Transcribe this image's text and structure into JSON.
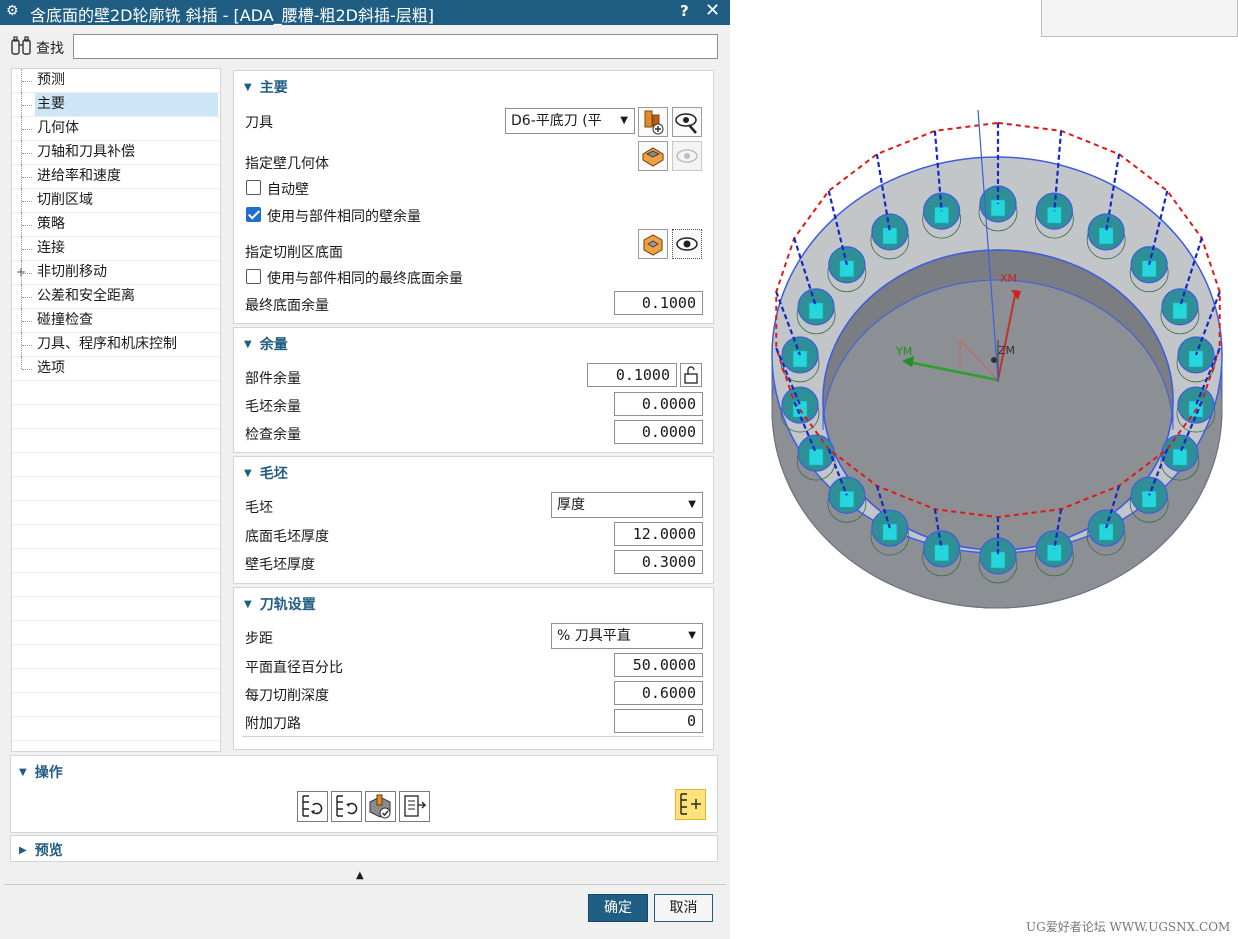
{
  "window": {
    "title": "含底面的壁2D轮廓铣 斜插 - [ADA_腰槽-粗2D斜插-层粗]",
    "help_label": "?",
    "close_label": "✕"
  },
  "find": {
    "label": "查找",
    "value": ""
  },
  "tree": {
    "items": [
      {
        "label": "预测",
        "selected": false,
        "expandable": false
      },
      {
        "label": "主要",
        "selected": true,
        "expandable": false
      },
      {
        "label": "几何体",
        "selected": false,
        "expandable": false
      },
      {
        "label": "刀轴和刀具补偿",
        "selected": false,
        "expandable": false
      },
      {
        "label": "进给率和速度",
        "selected": false,
        "expandable": false
      },
      {
        "label": "切削区域",
        "selected": false,
        "expandable": false
      },
      {
        "label": "策略",
        "selected": false,
        "expandable": false
      },
      {
        "label": "连接",
        "selected": false,
        "expandable": false
      },
      {
        "label": "非切削移动",
        "selected": false,
        "expandable": true
      },
      {
        "label": "公差和安全距离",
        "selected": false,
        "expandable": false
      },
      {
        "label": "碰撞检查",
        "selected": false,
        "expandable": false
      },
      {
        "label": "刀具、程序和机床控制",
        "selected": false,
        "expandable": false
      },
      {
        "label": "选项",
        "selected": false,
        "expandable": false
      }
    ]
  },
  "main_section": {
    "header": "主要",
    "tool_label": "刀具",
    "tool_value": "D6-平底刀 (平",
    "wall_geometry_label": "指定壁几何体",
    "auto_wall_label": "自动壁",
    "auto_wall_checked": false,
    "same_wall_stock_label": "使用与部件相同的壁余量",
    "same_wall_stock_checked": true,
    "cut_floor_label": "指定切削区底面",
    "same_floor_stock_label": "使用与部件相同的最终底面余量",
    "same_floor_stock_checked": false,
    "final_floor_stock_label": "最终底面余量",
    "final_floor_stock_value": "0.1000"
  },
  "stock_section": {
    "header": "余量",
    "part_stock_label": "部件余量",
    "part_stock_value": "0.1000",
    "blank_stock_label": "毛坯余量",
    "blank_stock_value": "0.0000",
    "check_stock_label": "检查余量",
    "check_stock_value": "0.0000"
  },
  "blank_section": {
    "header": "毛坯",
    "blank_label": "毛坯",
    "blank_value": "厚度",
    "floor_blank_thickness_label": "底面毛坯厚度",
    "floor_blank_thickness_value": "12.0000",
    "wall_blank_thickness_label": "壁毛坯厚度",
    "wall_blank_thickness_value": "0.3000"
  },
  "path_section": {
    "header": "刀轨设置",
    "stepover_label": "步距",
    "stepover_value": "% 刀具平直",
    "flat_diameter_percent_label": "平面直径百分比",
    "flat_diameter_percent_value": "50.0000",
    "depth_per_cut_label": "每刀切削深度",
    "depth_per_cut_value": "0.6000",
    "additional_paths_label": "附加刀路",
    "additional_paths_value": "0"
  },
  "operations": {
    "header": "操作"
  },
  "preview": {
    "header": "预览"
  },
  "footer": {
    "ok_label": "确定",
    "cancel_label": "取消"
  },
  "viewport": {
    "axis_xm": "XM",
    "axis_ym": "YM",
    "axis_zm": "ZM",
    "watermark": "UG爱好者论坛 WWW.UGSNX.COM"
  },
  "colors": {
    "title_bar": "#1f5d82",
    "accent": "#1f5d82",
    "selected_row": "#cde6f7",
    "checkbox_checked": "#1f6fc9",
    "part_body": "#b9bcbf",
    "part_edges": "#3f5de0",
    "pocket_fill": "#25d6dd",
    "toolpath_red": "#e01818",
    "toolpath_blue": "#1428c8"
  }
}
